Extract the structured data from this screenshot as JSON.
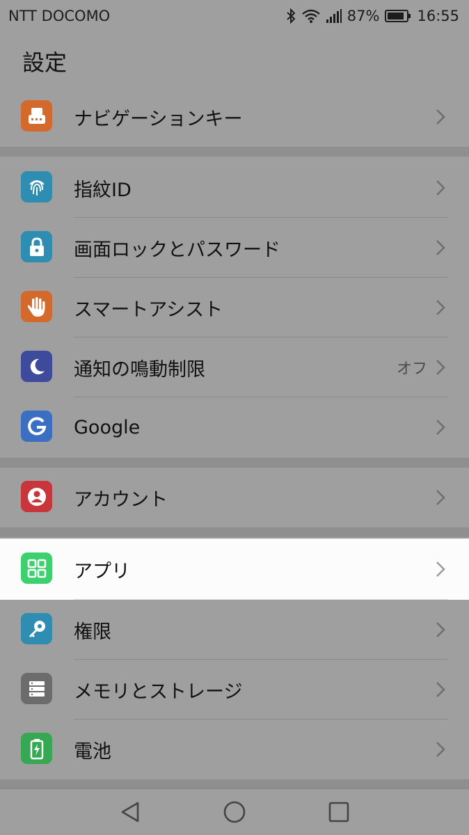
{
  "status": {
    "carrier": "NTT DOCOMO",
    "battery": "87%",
    "time": "16:55",
    "icons": [
      "bluetooth-icon",
      "wifi-icon",
      "signal-icon",
      "battery-icon"
    ]
  },
  "header": {
    "title": "設定"
  },
  "items": [
    {
      "label": "ナビゲーションキー",
      "icon": "navigation-key-icon",
      "color": "#d4692c"
    },
    {
      "label": "指紋ID",
      "icon": "fingerprint-icon",
      "color": "#2f8db2"
    },
    {
      "label": "画面ロックとパスワード",
      "icon": "lock-icon",
      "color": "#2f8db2"
    },
    {
      "label": "スマートアシスト",
      "icon": "hand-icon",
      "color": "#d4692c"
    },
    {
      "label": "通知の鳴動制限",
      "value": "オフ",
      "icon": "moon-icon",
      "color": "#3e4a9c"
    },
    {
      "label": "Google",
      "icon": "google-icon",
      "color": "#3b6fc1"
    },
    {
      "label": "アカウント",
      "icon": "account-icon",
      "color": "#c8363c"
    },
    {
      "label": "アプリ",
      "icon": "apps-icon",
      "color": "#3dd06f"
    },
    {
      "label": "権限",
      "icon": "key-icon",
      "color": "#2f8db2"
    },
    {
      "label": "メモリとストレージ",
      "icon": "storage-icon",
      "color": "#6c6c6c"
    },
    {
      "label": "電池",
      "icon": "battery-icon",
      "color": "#36a853"
    }
  ],
  "navbar": {
    "icons": [
      "back-icon",
      "home-icon",
      "recents-icon"
    ]
  }
}
